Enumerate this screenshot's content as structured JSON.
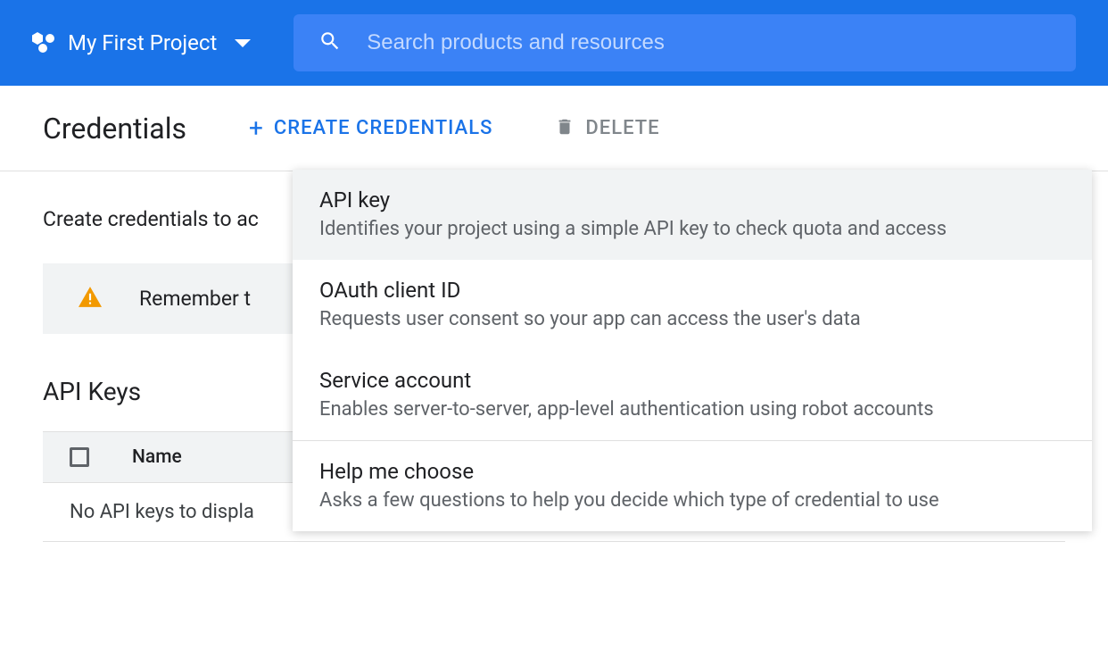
{
  "header": {
    "project_name": "My First Project",
    "search_placeholder": "Search products and resources"
  },
  "toolbar": {
    "title": "Credentials",
    "create_label": "CREATE CREDENTIALS",
    "delete_label": "DELETE"
  },
  "content": {
    "intro": "Create credentials to ac",
    "warning": "Remember t",
    "section_title": "API Keys",
    "col_name": "Name",
    "empty_message": "No API keys to displa"
  },
  "dropdown": {
    "items": [
      {
        "title": "API key",
        "desc": "Identifies your project using a simple API key to check quota and access"
      },
      {
        "title": "OAuth client ID",
        "desc": "Requests user consent so your app can access the user's data"
      },
      {
        "title": "Service account",
        "desc": "Enables server-to-server, app-level authentication using robot accounts"
      },
      {
        "title": "Help me choose",
        "desc": "Asks a few questions to help you decide which type of credential to use"
      }
    ]
  }
}
